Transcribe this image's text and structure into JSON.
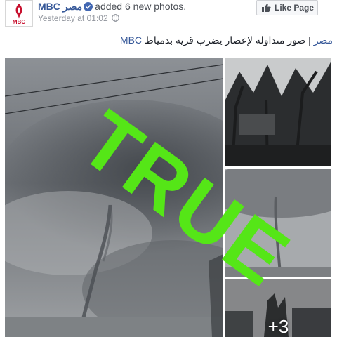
{
  "post": {
    "page": {
      "name_latin": "MBC",
      "name_arabic": "مصر",
      "logo_text": "MBC"
    },
    "action_text": "added 6 new photos.",
    "timestamp": "Yesterday at 01:02",
    "caption": {
      "mention": "MBC مصر",
      "separator": " | ",
      "text": "صور متداوله لإعصار يضرب قرية بدمياط"
    },
    "like_button_label": "Like Page",
    "icons": {
      "verified": "verified-badge-icon",
      "privacy": "globe-icon",
      "like": "thumbs-up-icon"
    },
    "photos": {
      "main": "tornado-funnel-cloud",
      "second": "storm-damaged-trees",
      "third": "distant-tornado",
      "fourth": "storm-damaged-buildings"
    },
    "more_photos_overlay": "+3",
    "overlay_stamp": {
      "text": "TRUE",
      "color": "#55e617"
    },
    "colors": {
      "link": "#365899",
      "meta": "#90949c",
      "text": "#1d2129"
    }
  }
}
